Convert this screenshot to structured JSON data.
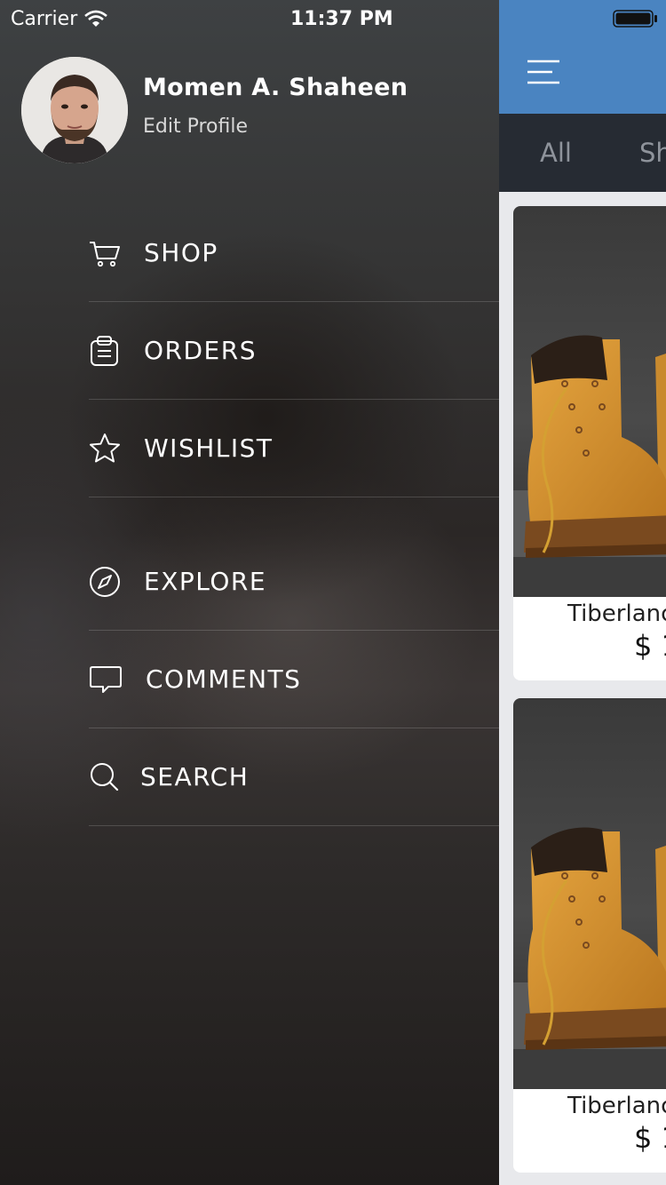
{
  "status_bar": {
    "carrier": "Carrier",
    "time": "11:37 PM"
  },
  "profile": {
    "name": "Momen A. Shaheen",
    "edit_label": "Edit Profile"
  },
  "menu": {
    "items": [
      {
        "label": "SHOP",
        "icon": "cart-icon"
      },
      {
        "label": "ORDERS",
        "icon": "clipboard-icon"
      },
      {
        "label": "WISHLIST",
        "icon": "star-icon"
      },
      {
        "label": "EXPLORE",
        "icon": "compass-icon"
      },
      {
        "label": "COMMENTS",
        "icon": "comment-icon"
      },
      {
        "label": "SEARCH",
        "icon": "search-icon"
      }
    ]
  },
  "main": {
    "header_color": "#4a84c1",
    "tabs": [
      "All",
      "Sh"
    ],
    "products": [
      {
        "name": "Tiberlanc",
        "price": "$ 1"
      },
      {
        "name": "Tiberlanc",
        "price": "$ 1"
      }
    ]
  }
}
